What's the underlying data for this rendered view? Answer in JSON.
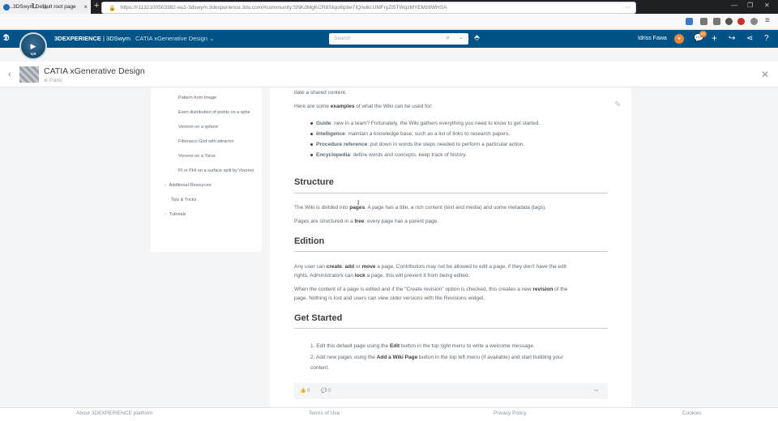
{
  "browser": {
    "tab_title": "3DSwym Default root page",
    "tab_close": "×",
    "new_tab": "+",
    "url": "https://r1132100503382-eu1-3dswym.3dexperience.3ds.com/#community:SNKdMgKCR8SIqo8Ipbe7IQ/wiki:UMFryZt5TWqzMYEMz8WHSA",
    "url_more": "···"
  },
  "app_header": {
    "brand_bold": "3DEXPERIENCE",
    "brand_rest": " | 3DSwym",
    "app_name": "CATIA xGenerative Design ⌄",
    "search_placeholder": "Search",
    "compass_label": "V,R",
    "user_name": "Idriss Fawa",
    "notification_count": "25"
  },
  "community": {
    "title": "CATIA xGenerative Design",
    "visibility": "Public"
  },
  "tree": {
    "items": [
      {
        "label": "Pattern from Image",
        "indent": 2
      },
      {
        "label": "Even distribution of points on a sphe",
        "indent": 2
      },
      {
        "label": "Voronoi on a sphere",
        "indent": 2
      },
      {
        "label": "Fibonacci Grid with attractor",
        "indent": 2
      },
      {
        "label": "Voronoi on a Torus",
        "indent": 2
      },
      {
        "label": "PI or PHI on a surface split by Voronoi",
        "indent": 2
      },
      {
        "label": "Additional Resources",
        "indent": 1,
        "expandable": true
      },
      {
        "label": "Tips & Tricks",
        "indent": 1
      },
      {
        "label": "Tutorials",
        "indent": 1,
        "expandable": true
      }
    ]
  },
  "article": {
    "intro_tail": "date a shared content.",
    "examples_pre": "Here are some ",
    "examples_bold": "examples",
    "examples_post": " of what the Wiki can be used for:",
    "bullets": [
      {
        "term": "Guide",
        "text": ": new in a team? Fortunately, the Wiki gathers everything you need to know to get started."
      },
      {
        "term": "Intelligence",
        "text": ": maintain a knowledge base, such as a list of links to research papers."
      },
      {
        "term": "Procedure reference",
        "text": ": put down in words the steps needed to perform a particular action."
      },
      {
        "term": "Encyclopedia",
        "text": ": define words and concepts, keep track of history."
      }
    ],
    "structure_heading": "Structure",
    "structure_p1_pre": "The Wiki is divided into ",
    "structure_p1_bold": "pages",
    "structure_p1_post": ". A page has a title, a rich content (text and media) and some metadata (tags).",
    "structure_p2_pre": "Pages are structured in a ",
    "structure_p2_bold": "tree",
    "structure_p2_post": ": every page has a parent page.",
    "edition_heading": "Edition",
    "edition_p1a_1": "Any user can ",
    "edition_p1a_b1": "create",
    "edition_p1a_2": ", ",
    "edition_p1a_b2": "add",
    "edition_p1a_3": " or ",
    "edition_p1a_b3": "move",
    "edition_p1a_4": " a page. Contributors may not be allowed to edit a page, if they don't have the edit",
    "edition_p1b_1": "rights. Administrators can ",
    "edition_p1b_b": "lock",
    "edition_p1b_2": " a page, this will prevent it from being edited.",
    "edition_p2a_1": "When the content of a page is edited and if the \"Create revision\" option is checked, this creates a new ",
    "edition_p2a_b": "revision",
    "edition_p2a_2": " of the",
    "edition_p2b": "page. Nothing is lost and users can view older versions with the Revisions widget.",
    "started_heading": "Get Started",
    "step1_pre": "1. Edit this default page using the ",
    "step1_bold": "Edit",
    "step1_post": " button in the top right menu to write a welcome message.",
    "step2_pre": "2. Add new pages using the ",
    "step2_bold": "Add a Wiki Page",
    "step2_post": " button in the top left menu (if available) and start building your",
    "step2_tail": "content.",
    "likes": "0",
    "comments": "0"
  },
  "footer": {
    "about": "About 3DEXPERIENCE platform",
    "terms": "Terms of Use",
    "privacy": "Privacy Policy",
    "cookies": "Cookies"
  }
}
